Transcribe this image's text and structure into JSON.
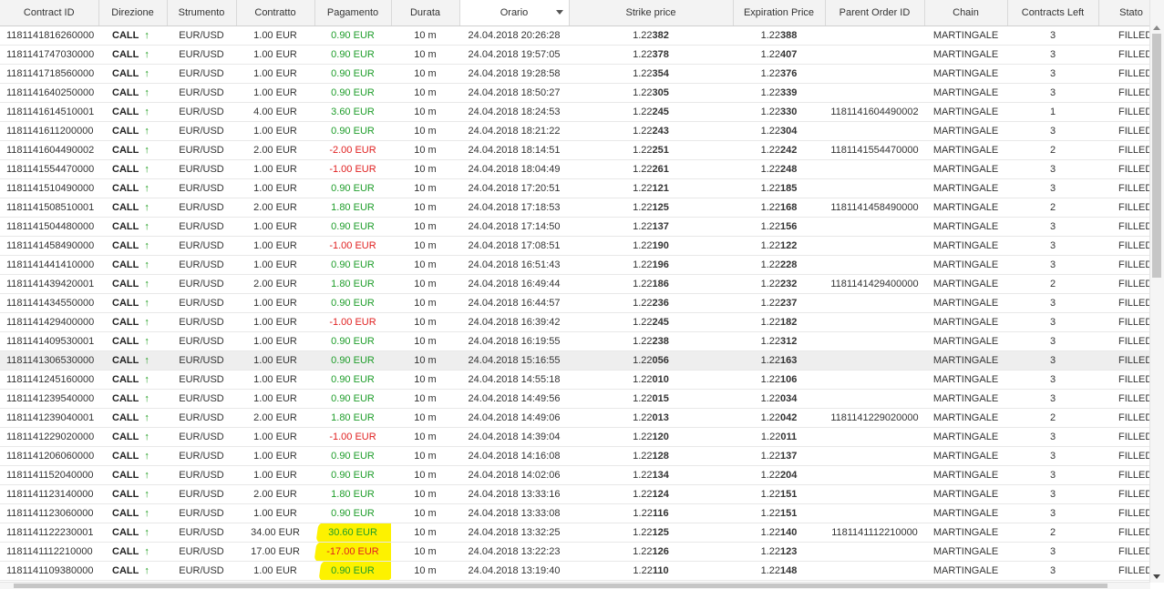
{
  "columns": [
    "Contract ID",
    "Direzione",
    "Strumento",
    "Contratto",
    "Pagamento",
    "Durata",
    "Orario",
    "Strike price",
    "Expiration Price",
    "Parent Order ID",
    "Chain",
    "Contracts Left",
    "Stato"
  ],
  "colors": {
    "positive": "#1e9d2a",
    "negative": "#e02020",
    "arrow": "#1a9a1a",
    "highlight": "#fdf200"
  },
  "rows": [
    {
      "id": "1181141816260000",
      "dir": "CALL",
      "inst": "EUR/USD",
      "contract": "1.00 EUR",
      "payment": "0.90 EUR",
      "sign": "pos",
      "duration": "10 m",
      "time": "24.04.2018 20:26:28",
      "strike_a": "1.22",
      "strike_b": "382",
      "exp_a": "1.22",
      "exp_b": "388",
      "parent": "",
      "chain": "MARTINGALE",
      "left": "3",
      "stato": "FILLED"
    },
    {
      "id": "1181141747030000",
      "dir": "CALL",
      "inst": "EUR/USD",
      "contract": "1.00 EUR",
      "payment": "0.90 EUR",
      "sign": "pos",
      "duration": "10 m",
      "time": "24.04.2018 19:57:05",
      "strike_a": "1.22",
      "strike_b": "378",
      "exp_a": "1.22",
      "exp_b": "407",
      "parent": "",
      "chain": "MARTINGALE",
      "left": "3",
      "stato": "FILLED"
    },
    {
      "id": "1181141718560000",
      "dir": "CALL",
      "inst": "EUR/USD",
      "contract": "1.00 EUR",
      "payment": "0.90 EUR",
      "sign": "pos",
      "duration": "10 m",
      "time": "24.04.2018 19:28:58",
      "strike_a": "1.22",
      "strike_b": "354",
      "exp_a": "1.22",
      "exp_b": "376",
      "parent": "",
      "chain": "MARTINGALE",
      "left": "3",
      "stato": "FILLED"
    },
    {
      "id": "1181141640250000",
      "dir": "CALL",
      "inst": "EUR/USD",
      "contract": "1.00 EUR",
      "payment": "0.90 EUR",
      "sign": "pos",
      "duration": "10 m",
      "time": "24.04.2018 18:50:27",
      "strike_a": "1.22",
      "strike_b": "305",
      "exp_a": "1.22",
      "exp_b": "339",
      "parent": "",
      "chain": "MARTINGALE",
      "left": "3",
      "stato": "FILLED"
    },
    {
      "id": "1181141614510001",
      "dir": "CALL",
      "inst": "EUR/USD",
      "contract": "4.00 EUR",
      "payment": "3.60 EUR",
      "sign": "pos",
      "duration": "10 m",
      "time": "24.04.2018 18:24:53",
      "strike_a": "1.22",
      "strike_b": "245",
      "exp_a": "1.22",
      "exp_b": "330",
      "parent": "1181141604490002",
      "chain": "MARTINGALE",
      "left": "1",
      "stato": "FILLED"
    },
    {
      "id": "1181141611200000",
      "dir": "CALL",
      "inst": "EUR/USD",
      "contract": "1.00 EUR",
      "payment": "0.90 EUR",
      "sign": "pos",
      "duration": "10 m",
      "time": "24.04.2018 18:21:22",
      "strike_a": "1.22",
      "strike_b": "243",
      "exp_a": "1.22",
      "exp_b": "304",
      "parent": "",
      "chain": "MARTINGALE",
      "left": "3",
      "stato": "FILLED"
    },
    {
      "id": "1181141604490002",
      "dir": "CALL",
      "inst": "EUR/USD",
      "contract": "2.00 EUR",
      "payment": "-2.00 EUR",
      "sign": "neg",
      "duration": "10 m",
      "time": "24.04.2018 18:14:51",
      "strike_a": "1.22",
      "strike_b": "251",
      "exp_a": "1.22",
      "exp_b": "242",
      "parent": "1181141554470000",
      "chain": "MARTINGALE",
      "left": "2",
      "stato": "FILLED"
    },
    {
      "id": "1181141554470000",
      "dir": "CALL",
      "inst": "EUR/USD",
      "contract": "1.00 EUR",
      "payment": "-1.00 EUR",
      "sign": "neg",
      "duration": "10 m",
      "time": "24.04.2018 18:04:49",
      "strike_a": "1.22",
      "strike_b": "261",
      "exp_a": "1.22",
      "exp_b": "248",
      "parent": "",
      "chain": "MARTINGALE",
      "left": "3",
      "stato": "FILLED"
    },
    {
      "id": "1181141510490000",
      "dir": "CALL",
      "inst": "EUR/USD",
      "contract": "1.00 EUR",
      "payment": "0.90 EUR",
      "sign": "pos",
      "duration": "10 m",
      "time": "24.04.2018 17:20:51",
      "strike_a": "1.22",
      "strike_b": "121",
      "exp_a": "1.22",
      "exp_b": "185",
      "parent": "",
      "chain": "MARTINGALE",
      "left": "3",
      "stato": "FILLED"
    },
    {
      "id": "1181141508510001",
      "dir": "CALL",
      "inst": "EUR/USD",
      "contract": "2.00 EUR",
      "payment": "1.80 EUR",
      "sign": "pos",
      "duration": "10 m",
      "time": "24.04.2018 17:18:53",
      "strike_a": "1.22",
      "strike_b": "125",
      "exp_a": "1.22",
      "exp_b": "168",
      "parent": "1181141458490000",
      "chain": "MARTINGALE",
      "left": "2",
      "stato": "FILLED"
    },
    {
      "id": "1181141504480000",
      "dir": "CALL",
      "inst": "EUR/USD",
      "contract": "1.00 EUR",
      "payment": "0.90 EUR",
      "sign": "pos",
      "duration": "10 m",
      "time": "24.04.2018 17:14:50",
      "strike_a": "1.22",
      "strike_b": "137",
      "exp_a": "1.22",
      "exp_b": "156",
      "parent": "",
      "chain": "MARTINGALE",
      "left": "3",
      "stato": "FILLED"
    },
    {
      "id": "1181141458490000",
      "dir": "CALL",
      "inst": "EUR/USD",
      "contract": "1.00 EUR",
      "payment": "-1.00 EUR",
      "sign": "neg",
      "duration": "10 m",
      "time": "24.04.2018 17:08:51",
      "strike_a": "1.22",
      "strike_b": "190",
      "exp_a": "1.22",
      "exp_b": "122",
      "parent": "",
      "chain": "MARTINGALE",
      "left": "3",
      "stato": "FILLED"
    },
    {
      "id": "1181141441410000",
      "dir": "CALL",
      "inst": "EUR/USD",
      "contract": "1.00 EUR",
      "payment": "0.90 EUR",
      "sign": "pos",
      "duration": "10 m",
      "time": "24.04.2018 16:51:43",
      "strike_a": "1.22",
      "strike_b": "196",
      "exp_a": "1.22",
      "exp_b": "228",
      "parent": "",
      "chain": "MARTINGALE",
      "left": "3",
      "stato": "FILLED"
    },
    {
      "id": "1181141439420001",
      "dir": "CALL",
      "inst": "EUR/USD",
      "contract": "2.00 EUR",
      "payment": "1.80 EUR",
      "sign": "pos",
      "duration": "10 m",
      "time": "24.04.2018 16:49:44",
      "strike_a": "1.22",
      "strike_b": "186",
      "exp_a": "1.22",
      "exp_b": "232",
      "parent": "1181141429400000",
      "chain": "MARTINGALE",
      "left": "2",
      "stato": "FILLED"
    },
    {
      "id": "1181141434550000",
      "dir": "CALL",
      "inst": "EUR/USD",
      "contract": "1.00 EUR",
      "payment": "0.90 EUR",
      "sign": "pos",
      "duration": "10 m",
      "time": "24.04.2018 16:44:57",
      "strike_a": "1.22",
      "strike_b": "236",
      "exp_a": "1.22",
      "exp_b": "237",
      "parent": "",
      "chain": "MARTINGALE",
      "left": "3",
      "stato": "FILLED"
    },
    {
      "id": "1181141429400000",
      "dir": "CALL",
      "inst": "EUR/USD",
      "contract": "1.00 EUR",
      "payment": "-1.00 EUR",
      "sign": "neg",
      "duration": "10 m",
      "time": "24.04.2018 16:39:42",
      "strike_a": "1.22",
      "strike_b": "245",
      "exp_a": "1.22",
      "exp_b": "182",
      "parent": "",
      "chain": "MARTINGALE",
      "left": "3",
      "stato": "FILLED"
    },
    {
      "id": "1181141409530001",
      "dir": "CALL",
      "inst": "EUR/USD",
      "contract": "1.00 EUR",
      "payment": "0.90 EUR",
      "sign": "pos",
      "duration": "10 m",
      "time": "24.04.2018 16:19:55",
      "strike_a": "1.22",
      "strike_b": "238",
      "exp_a": "1.22",
      "exp_b": "312",
      "parent": "",
      "chain": "MARTINGALE",
      "left": "3",
      "stato": "FILLED"
    },
    {
      "id": "1181141306530000",
      "dir": "CALL",
      "inst": "EUR/USD",
      "contract": "1.00 EUR",
      "payment": "0.90 EUR",
      "sign": "pos",
      "duration": "10 m",
      "time": "24.04.2018 15:16:55",
      "strike_a": "1.22",
      "strike_b": "056",
      "exp_a": "1.22",
      "exp_b": "163",
      "parent": "",
      "chain": "MARTINGALE",
      "left": "3",
      "stato": "FILLED",
      "hover": true
    },
    {
      "id": "1181141245160000",
      "dir": "CALL",
      "inst": "EUR/USD",
      "contract": "1.00 EUR",
      "payment": "0.90 EUR",
      "sign": "pos",
      "duration": "10 m",
      "time": "24.04.2018 14:55:18",
      "strike_a": "1.22",
      "strike_b": "010",
      "exp_a": "1.22",
      "exp_b": "106",
      "parent": "",
      "chain": "MARTINGALE",
      "left": "3",
      "stato": "FILLED"
    },
    {
      "id": "1181141239540000",
      "dir": "CALL",
      "inst": "EUR/USD",
      "contract": "1.00 EUR",
      "payment": "0.90 EUR",
      "sign": "pos",
      "duration": "10 m",
      "time": "24.04.2018 14:49:56",
      "strike_a": "1.22",
      "strike_b": "015",
      "exp_a": "1.22",
      "exp_b": "034",
      "parent": "",
      "chain": "MARTINGALE",
      "left": "3",
      "stato": "FILLED"
    },
    {
      "id": "1181141239040001",
      "dir": "CALL",
      "inst": "EUR/USD",
      "contract": "2.00 EUR",
      "payment": "1.80 EUR",
      "sign": "pos",
      "duration": "10 m",
      "time": "24.04.2018 14:49:06",
      "strike_a": "1.22",
      "strike_b": "013",
      "exp_a": "1.22",
      "exp_b": "042",
      "parent": "1181141229020000",
      "chain": "MARTINGALE",
      "left": "2",
      "stato": "FILLED"
    },
    {
      "id": "1181141229020000",
      "dir": "CALL",
      "inst": "EUR/USD",
      "contract": "1.00 EUR",
      "payment": "-1.00 EUR",
      "sign": "neg",
      "duration": "10 m",
      "time": "24.04.2018 14:39:04",
      "strike_a": "1.22",
      "strike_b": "120",
      "exp_a": "1.22",
      "exp_b": "011",
      "parent": "",
      "chain": "MARTINGALE",
      "left": "3",
      "stato": "FILLED"
    },
    {
      "id": "1181141206060000",
      "dir": "CALL",
      "inst": "EUR/USD",
      "contract": "1.00 EUR",
      "payment": "0.90 EUR",
      "sign": "pos",
      "duration": "10 m",
      "time": "24.04.2018 14:16:08",
      "strike_a": "1.22",
      "strike_b": "128",
      "exp_a": "1.22",
      "exp_b": "137",
      "parent": "",
      "chain": "MARTINGALE",
      "left": "3",
      "stato": "FILLED"
    },
    {
      "id": "1181141152040000",
      "dir": "CALL",
      "inst": "EUR/USD",
      "contract": "1.00 EUR",
      "payment": "0.90 EUR",
      "sign": "pos",
      "duration": "10 m",
      "time": "24.04.2018 14:02:06",
      "strike_a": "1.22",
      "strike_b": "134",
      "exp_a": "1.22",
      "exp_b": "204",
      "parent": "",
      "chain": "MARTINGALE",
      "left": "3",
      "stato": "FILLED"
    },
    {
      "id": "1181141123140000",
      "dir": "CALL",
      "inst": "EUR/USD",
      "contract": "2.00 EUR",
      "payment": "1.80 EUR",
      "sign": "pos",
      "duration": "10 m",
      "time": "24.04.2018 13:33:16",
      "strike_a": "1.22",
      "strike_b": "124",
      "exp_a": "1.22",
      "exp_b": "151",
      "parent": "",
      "chain": "MARTINGALE",
      "left": "3",
      "stato": "FILLED"
    },
    {
      "id": "1181141123060000",
      "dir": "CALL",
      "inst": "EUR/USD",
      "contract": "1.00 EUR",
      "payment": "0.90 EUR",
      "sign": "pos",
      "duration": "10 m",
      "time": "24.04.2018 13:33:08",
      "strike_a": "1.22",
      "strike_b": "116",
      "exp_a": "1.22",
      "exp_b": "151",
      "parent": "",
      "chain": "MARTINGALE",
      "left": "3",
      "stato": "FILLED"
    },
    {
      "id": "1181141122230001",
      "dir": "CALL",
      "inst": "EUR/USD",
      "contract": "34.00 EUR",
      "payment": "30.60 EUR",
      "sign": "pos",
      "duration": "10 m",
      "time": "24.04.2018 13:32:25",
      "strike_a": "1.22",
      "strike_b": "125",
      "exp_a": "1.22",
      "exp_b": "140",
      "parent": "1181141112210000",
      "chain": "MARTINGALE",
      "left": "2",
      "stato": "FILLED",
      "marked": true
    },
    {
      "id": "1181141112210000",
      "dir": "CALL",
      "inst": "EUR/USD",
      "contract": "17.00 EUR",
      "payment": "-17.00 EUR",
      "sign": "neg",
      "duration": "10 m",
      "time": "24.04.2018 13:22:23",
      "strike_a": "1.22",
      "strike_b": "126",
      "exp_a": "1.22",
      "exp_b": "123",
      "parent": "",
      "chain": "MARTINGALE",
      "left": "3",
      "stato": "FILLED",
      "marked": true
    },
    {
      "id": "1181141109380000",
      "dir": "CALL",
      "inst": "EUR/USD",
      "contract": "1.00 EUR",
      "payment": "0.90 EUR",
      "sign": "pos",
      "duration": "10 m",
      "time": "24.04.2018 13:19:40",
      "strike_a": "1.22",
      "strike_b": "110",
      "exp_a": "1.22",
      "exp_b": "148",
      "parent": "",
      "chain": "MARTINGALE",
      "left": "3",
      "stato": "FILLED",
      "marked": true
    }
  ]
}
